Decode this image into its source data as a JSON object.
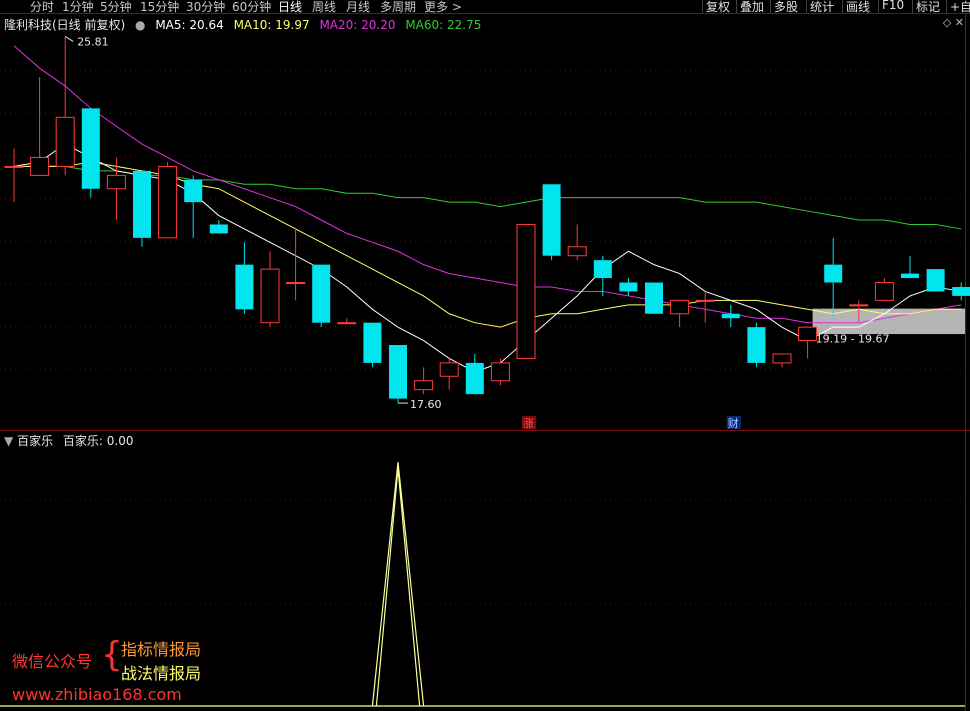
{
  "toolbar": {
    "tabs": [
      {
        "label": "分时",
        "x": 30
      },
      {
        "label": "1分钟",
        "x": 62
      },
      {
        "label": "5分钟",
        "x": 100
      },
      {
        "label": "15分钟",
        "x": 140
      },
      {
        "label": "30分钟",
        "x": 186
      },
      {
        "label": "60分钟",
        "x": 232
      },
      {
        "label": "日线",
        "x": 278,
        "active": true
      },
      {
        "label": "周线",
        "x": 312
      },
      {
        "label": "月线",
        "x": 346
      },
      {
        "label": "多周期",
        "x": 380
      },
      {
        "label": "更多 >",
        "x": 424
      }
    ],
    "right_buttons": [
      {
        "label": "复权",
        "x": 706
      },
      {
        "label": "叠加",
        "x": 740
      },
      {
        "label": "多股",
        "x": 774
      },
      {
        "label": "统计",
        "x": 810
      },
      {
        "label": "画线",
        "x": 846
      },
      {
        "label": "F10",
        "x": 882
      },
      {
        "label": "标记",
        "x": 916
      },
      {
        "label": "+自选",
        "x": 950
      }
    ]
  },
  "main_header": {
    "stock": "隆利科技(日线 前复权)",
    "ma5": "MA5: 20.64",
    "ma10": "MA10: 19.97",
    "ma20": "MA20: 20.20",
    "ma60": "MA60: 22.75"
  },
  "indicator_header": {
    "name": "百家乐",
    "value": "百家乐: 0.00"
  },
  "annotations": {
    "high": "25.81",
    "low": "17.60",
    "range": "19.19 - 19.67",
    "marker_zhang": "涨",
    "marker_cai": "财"
  },
  "watermark": {
    "wechat": "微信公众号",
    "line1": "指标情报局",
    "line2": "战法情报局",
    "url": "www.zhibiao168.com"
  },
  "colors": {
    "up": "#ff3b3b",
    "down": "#00e5ee",
    "ma5": "#ffffff",
    "ma10": "#ffff66",
    "ma20": "#dd33dd",
    "ma60": "#33cc33",
    "indicator": "#ffff99"
  },
  "chart_data": {
    "type": "candlestick",
    "candles": [
      {
        "o": 22.9,
        "c": 22.9,
        "h": 23.3,
        "l": 22.1
      },
      {
        "o": 22.7,
        "c": 23.1,
        "h": 24.9,
        "l": 22.7
      },
      {
        "o": 22.9,
        "c": 24.0,
        "h": 25.81,
        "l": 22.7
      },
      {
        "o": 24.2,
        "c": 22.4,
        "h": 24.2,
        "l": 22.2
      },
      {
        "o": 22.4,
        "c": 22.7,
        "h": 23.1,
        "l": 21.7
      },
      {
        "o": 22.8,
        "c": 21.3,
        "h": 22.8,
        "l": 21.1
      },
      {
        "o": 21.3,
        "c": 22.9,
        "h": 23.0,
        "l": 21.3
      },
      {
        "o": 22.6,
        "c": 22.1,
        "h": 22.7,
        "l": 21.3
      },
      {
        "o": 21.6,
        "c": 21.4,
        "h": 21.7,
        "l": 21.4
      },
      {
        "o": 20.7,
        "c": 19.7,
        "h": 21.2,
        "l": 19.6
      },
      {
        "o": 19.4,
        "c": 20.6,
        "h": 21.0,
        "l": 19.3
      },
      {
        "o": 20.3,
        "c": 20.3,
        "h": 21.5,
        "l": 19.9
      },
      {
        "o": 20.7,
        "c": 19.4,
        "h": 20.7,
        "l": 19.3
      },
      {
        "o": 19.4,
        "c": 19.4,
        "h": 19.5,
        "l": 19.4
      },
      {
        "o": 19.4,
        "c": 18.5,
        "h": 19.4,
        "l": 18.4
      },
      {
        "o": 18.9,
        "c": 17.7,
        "h": 18.9,
        "l": 17.6
      },
      {
        "o": 17.9,
        "c": 18.1,
        "h": 18.4,
        "l": 17.8
      },
      {
        "o": 18.2,
        "c": 18.5,
        "h": 18.6,
        "l": 17.9
      },
      {
        "o": 18.5,
        "c": 17.8,
        "h": 18.7,
        "l": 17.8
      },
      {
        "o": 18.1,
        "c": 18.5,
        "h": 18.6,
        "l": 18.0
      },
      {
        "o": 18.6,
        "c": 21.6,
        "h": 21.6,
        "l": 18.6
      },
      {
        "o": 22.5,
        "c": 20.9,
        "h": 22.5,
        "l": 20.8
      },
      {
        "o": 20.9,
        "c": 21.1,
        "h": 21.6,
        "l": 20.8
      },
      {
        "o": 20.8,
        "c": 20.4,
        "h": 20.9,
        "l": 20.0
      },
      {
        "o": 20.3,
        "c": 20.1,
        "h": 20.4,
        "l": 20.0
      },
      {
        "o": 20.3,
        "c": 19.6,
        "h": 20.3,
        "l": 19.6
      },
      {
        "o": 19.6,
        "c": 19.9,
        "h": 19.9,
        "l": 19.3
      },
      {
        "o": 19.9,
        "c": 19.9,
        "h": 20.1,
        "l": 19.4
      },
      {
        "o": 19.6,
        "c": 19.5,
        "h": 19.8,
        "l": 19.3
      },
      {
        "o": 19.3,
        "c": 18.5,
        "h": 19.4,
        "l": 18.4
      },
      {
        "o": 18.5,
        "c": 18.7,
        "h": 18.7,
        "l": 18.4
      },
      {
        "o": 19.0,
        "c": 19.3,
        "h": 19.3,
        "l": 18.6
      },
      {
        "o": 20.7,
        "c": 20.3,
        "h": 21.3,
        "l": 19.5
      },
      {
        "o": 19.8,
        "c": 19.8,
        "h": 19.9,
        "l": 19.4
      },
      {
        "o": 19.9,
        "c": 20.3,
        "h": 20.4,
        "l": 19.9
      },
      {
        "o": 20.5,
        "c": 20.4,
        "h": 20.9,
        "l": 20.4
      },
      {
        "o": 20.6,
        "c": 20.1,
        "h": 20.6,
        "l": 20.1
      },
      {
        "o": 20.2,
        "c": 20.0,
        "h": 20.3,
        "l": 19.9
      }
    ],
    "ma5": [
      22.9,
      23.0,
      23.4,
      23.1,
      22.8,
      22.7,
      22.6,
      22.3,
      21.8,
      21.5,
      21.2,
      20.9,
      20.6,
      20.2,
      19.7,
      19.3,
      19.0,
      18.6,
      18.3,
      18.5,
      19.0,
      19.5,
      20.0,
      20.6,
      21.0,
      20.7,
      20.5,
      20.1,
      19.9,
      19.7,
      19.3,
      19.0,
      19.3,
      19.3,
      19.6,
      20.0,
      20.2,
      20.1
    ],
    "ma10": [
      22.9,
      22.9,
      22.9,
      23.0,
      22.9,
      22.8,
      22.7,
      22.5,
      22.4,
      22.1,
      21.8,
      21.5,
      21.2,
      20.9,
      20.6,
      20.3,
      20.0,
      19.6,
      19.4,
      19.3,
      19.5,
      19.6,
      19.6,
      19.7,
      19.8,
      19.8,
      19.8,
      19.9,
      19.9,
      19.9,
      19.8,
      19.7,
      19.6,
      19.7,
      19.6,
      19.6,
      19.7,
      19.7
    ],
    "ma20": [
      25.6,
      25.1,
      24.7,
      24.2,
      23.8,
      23.4,
      23.1,
      22.8,
      22.6,
      22.4,
      22.2,
      22.0,
      21.7,
      21.4,
      21.2,
      21.0,
      20.7,
      20.5,
      20.4,
      20.3,
      20.2,
      20.2,
      20.1,
      20.1,
      20.0,
      19.9,
      19.8,
      19.7,
      19.6,
      19.5,
      19.5,
      19.4,
      19.4,
      19.4,
      19.5,
      19.6,
      19.7,
      19.8
    ],
    "ma60": [
      22.9,
      22.9,
      22.9,
      22.8,
      22.8,
      22.7,
      22.7,
      22.6,
      22.6,
      22.5,
      22.5,
      22.4,
      22.4,
      22.3,
      22.3,
      22.2,
      22.2,
      22.1,
      22.1,
      22.0,
      22.1,
      22.2,
      22.2,
      22.2,
      22.2,
      22.2,
      22.2,
      22.1,
      22.1,
      22.1,
      22.0,
      21.9,
      21.8,
      21.7,
      21.7,
      21.6,
      21.6,
      21.5
    ],
    "ylim": [
      17.4,
      26.0
    ],
    "range_band": [
      19.19,
      19.67
    ],
    "indicator": {
      "name": "百家乐",
      "x_peak_index": 15,
      "peak": 1.0,
      "values": [
        0,
        0,
        0,
        0,
        0,
        0,
        0,
        0,
        0,
        0,
        0,
        0,
        0,
        0,
        0,
        1.0,
        0,
        0,
        0,
        0,
        0,
        0,
        0,
        0,
        0,
        0,
        0,
        0,
        0,
        0,
        0,
        0,
        0,
        0,
        0,
        0,
        0,
        0
      ],
      "ylim": [
        0,
        1.05
      ]
    }
  }
}
